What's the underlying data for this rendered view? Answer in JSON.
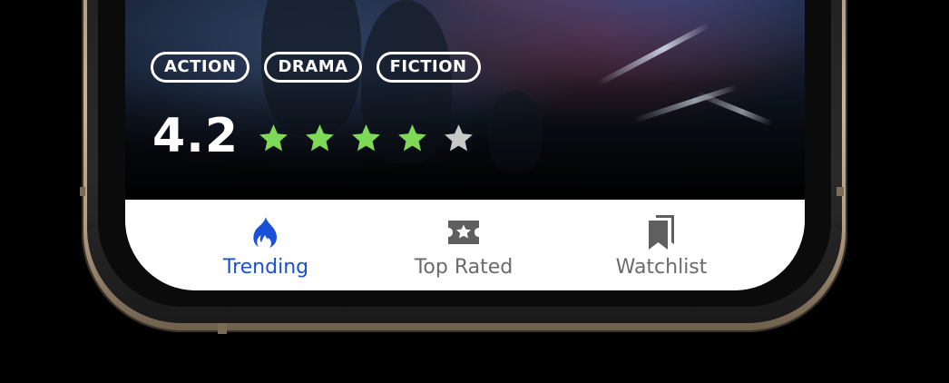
{
  "genres": [
    "ACTION",
    "DRAMA",
    "FICTION"
  ],
  "rating": {
    "value": "4.2",
    "stars_filled": 4,
    "stars_total": 5,
    "filled_color": "#7ed957",
    "empty_color": "#c8c8c8"
  },
  "tabs": [
    {
      "label": "Trending",
      "icon": "flame-icon",
      "active": true
    },
    {
      "label": "Top Rated",
      "icon": "ticket-star-icon",
      "active": false
    },
    {
      "label": "Watchlist",
      "icon": "bookmarks-icon",
      "active": false
    }
  ],
  "colors": {
    "active_tab": "#1a4fd8",
    "inactive_tab": "#6b6b6b",
    "inactive_icon": "#5f5f5f"
  }
}
